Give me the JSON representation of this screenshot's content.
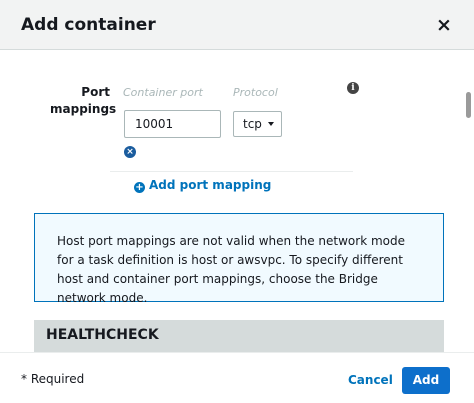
{
  "modal": {
    "title": "Add container",
    "close_icon": "close-icon",
    "close_glyph": "×"
  },
  "port_mappings": {
    "label": "Port mappings",
    "container_port_header": "Container port",
    "protocol_header": "Protocol",
    "info_icon": "info-icon",
    "info_glyph": "i",
    "container_port_value": "10001",
    "protocol_value": "tcp",
    "remove_icon": "remove-circle-icon",
    "remove_glyph": "×",
    "add_mapping_label": "Add port mapping",
    "add_icon": "plus-circle-icon",
    "add_glyph": "+"
  },
  "alert": {
    "text": "Host port mappings are not valid when the network mode for a task definition is host or awsvpc. To specify different host and container port mappings, choose the Bridge network mode."
  },
  "healthcheck": {
    "title": "HEALTHCHECK"
  },
  "footer": {
    "required_note": "* Required",
    "cancel_label": "Cancel",
    "add_label": "Add"
  },
  "colors": {
    "accent": "#0073bb",
    "primary_button": "#0d6fcb",
    "alert_bg": "#f1faff",
    "section_bar": "#d5dbdb"
  }
}
